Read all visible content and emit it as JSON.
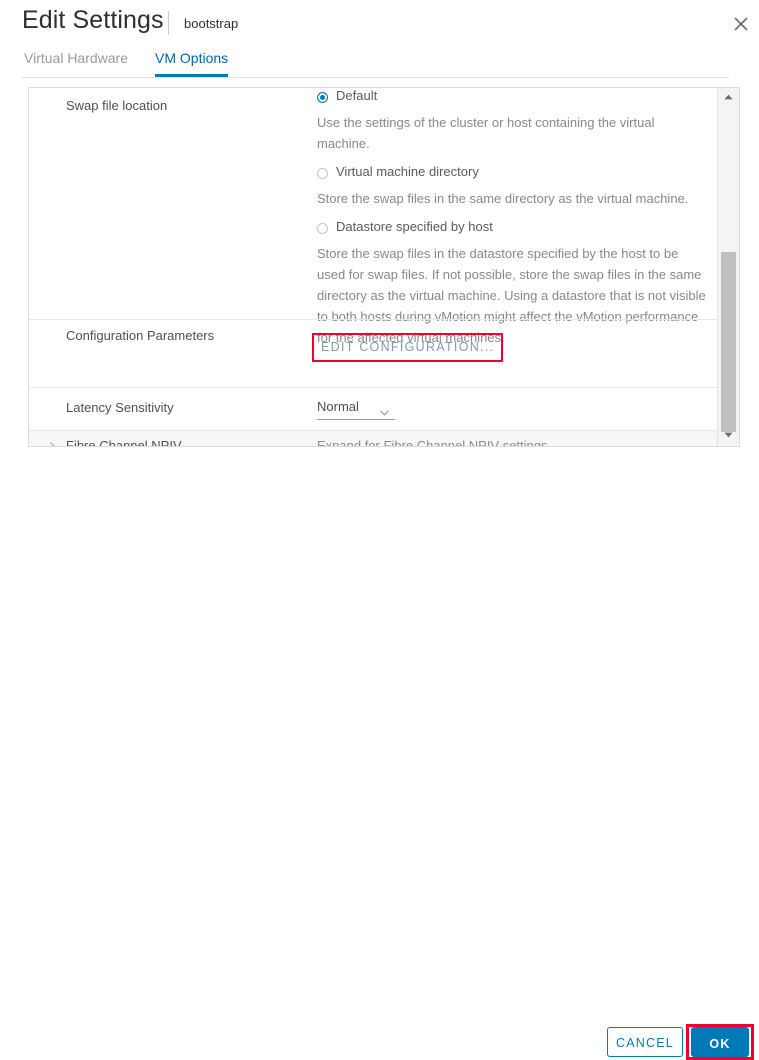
{
  "window": {
    "title": "Edit Settings",
    "subtitle": "bootstrap",
    "close_icon": "close-icon"
  },
  "tabs": [
    {
      "label": "Virtual Hardware",
      "active": false
    },
    {
      "label": "VM Options",
      "active": true
    }
  ],
  "settings": {
    "swap_file_location": {
      "label": "Swap file location",
      "options": [
        {
          "label": "Default",
          "selected": true,
          "description": "Use the settings of the cluster or host containing the virtual machine."
        },
        {
          "label": "Virtual machine directory",
          "selected": false,
          "description": "Store the swap files in the same directory as the virtual machine."
        },
        {
          "label": "Datastore specified by host",
          "selected": false,
          "description": "Store the swap files in the datastore specified by the host to be used for swap files. If not possible, store the swap files in the same directory as the virtual machine. Using a datastore that is not visible to both hosts during vMotion might affect the vMotion performance for the affected virtual machines."
        }
      ]
    },
    "configuration_parameters": {
      "label": "Configuration Parameters",
      "button_label": "EDIT CONFIGURATION...",
      "highlighted": true
    },
    "latency_sensitivity": {
      "label": "Latency Sensitivity",
      "value": "Normal",
      "caret_icon": "chevron-down-icon"
    },
    "fibre_channel_npiv": {
      "label": "Fibre Channel NPIV",
      "hint": "Expand for Fibre Channel NPIV settings",
      "expander_icon": "chevron-right-icon",
      "expanded": false
    }
  },
  "scrollbar": {
    "up_icon": "caret-up-icon",
    "down_icon": "caret-down-icon"
  },
  "footer": {
    "cancel_label": "CANCEL",
    "ok_label": "OK",
    "ok_highlighted": true
  },
  "colors": {
    "accent": "#0079b8",
    "highlight": "#ee0033",
    "text": "#565656",
    "muted": "#8d8d8d"
  }
}
